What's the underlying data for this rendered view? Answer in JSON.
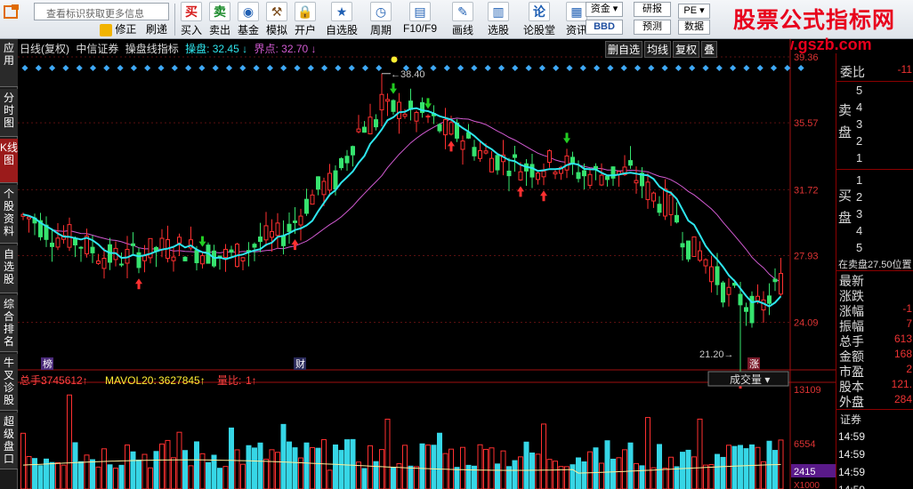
{
  "toolbar": {
    "search_placeholder": "查看标识获取更多信息",
    "sub_buttons": [
      "修正",
      "刷递"
    ],
    "buttons": [
      {
        "id": "buy",
        "label": "买入",
        "icon": "buy-icon",
        "glyph": "买",
        "color": "#d61b1b"
      },
      {
        "id": "sell",
        "label": "卖出",
        "icon": "sell-icon",
        "glyph": "卖",
        "color": "#1a8a2a"
      },
      {
        "id": "fund",
        "label": "基金",
        "icon": "fund-icon",
        "glyph": "◉",
        "color": "#1f5fb3"
      },
      {
        "id": "simulate",
        "label": "模拟",
        "icon": "hammer-icon",
        "glyph": "⚒",
        "color": "#7a4a1a"
      },
      {
        "id": "open",
        "label": "开户",
        "icon": "lock-icon",
        "glyph": "🔒",
        "color": "#555"
      },
      {
        "id": "watchlist",
        "label": "自选股",
        "icon": "star-icon",
        "glyph": "★",
        "color": "#1f5fb3"
      },
      {
        "id": "period",
        "label": "周期",
        "icon": "clock-icon",
        "glyph": "◷",
        "color": "#1f5fb3"
      },
      {
        "id": "f10",
        "label": "F10/F9",
        "icon": "document-icon",
        "glyph": "▤",
        "color": "#1f5fb3"
      },
      {
        "id": "draw",
        "label": "画线",
        "icon": "pencil-icon",
        "glyph": "✎",
        "color": "#1f5fb3"
      },
      {
        "id": "select",
        "label": "选股",
        "icon": "filter-icon",
        "glyph": "▥",
        "color": "#1f5fb3"
      },
      {
        "id": "forum",
        "label": "论股堂",
        "icon": "forum-icon",
        "glyph": "论",
        "color": "#1f5fb3"
      },
      {
        "id": "news",
        "label": "资讯",
        "icon": "news-icon",
        "glyph": "▦",
        "color": "#1f5fb3"
      }
    ],
    "mini_buttons": [
      "资金",
      "研报",
      "PE",
      "BBD",
      "预测",
      "数据"
    ]
  },
  "brand": {
    "title": "股票公式指标网",
    "url": "www.gszb.com"
  },
  "side_tabs": [
    {
      "label": "应用"
    },
    {
      "label": "分时图"
    },
    {
      "label": "K线图"
    },
    {
      "label": "个股资料"
    },
    {
      "label": "自选股"
    },
    {
      "label": "综合排名"
    },
    {
      "label": "牛叉诊股"
    },
    {
      "label": "超级盘口"
    }
  ],
  "chart_header": {
    "period": "日线(复权)",
    "stock": "中信证券",
    "indicator_name": "操盘线指标",
    "caopan_label": "操盘:",
    "caopan_value": "32.45",
    "jiedian_label": "界点:",
    "jiedian_value": "32.70"
  },
  "chart_tabs": [
    "删自选",
    "均线",
    "复权",
    "叠"
  ],
  "price_axis": [
    "39.36",
    "35.57",
    "31.72",
    "27.93",
    "24.09"
  ],
  "annotations": {
    "high": "38.40",
    "low": "21.20",
    "tag_bang": "榜",
    "tag_cai": "财",
    "tag_zhang": "涨"
  },
  "volume_header": {
    "total_label": "总手:",
    "total_value": "3745612",
    "mavol_label": "MAVOL20:",
    "mavol_value": "3627845",
    "ratio_label": "量比:",
    "ratio_value": "1",
    "dropdown": "成交量"
  },
  "volume_axis": [
    "13109",
    "6554",
    "2415",
    "X1000"
  ],
  "chart_data": {
    "type": "candlestick",
    "price_range": [
      21.2,
      39.36
    ],
    "volume_unit": "X1000",
    "volume_range": [
      0,
      13109
    ],
    "series": [
      {
        "name": "操盘",
        "color": "#2ee6ee"
      },
      {
        "name": "界点",
        "color": "#d05ad0"
      }
    ]
  },
  "quote": {
    "weibi_label": "委比",
    "weibi_value": "-11",
    "sell_label": "卖盘",
    "buy_label": "买盘",
    "levels": [
      "5",
      "4",
      "3",
      "2",
      "1"
    ],
    "sell_note": "在卖盘27.50位置",
    "stats": [
      {
        "label": "最新",
        "value": ""
      },
      {
        "label": "涨跌",
        "value": ""
      },
      {
        "label": "涨幅",
        "value": "-1"
      },
      {
        "label": "振幅",
        "value": "7"
      },
      {
        "label": "总手",
        "value": "613"
      },
      {
        "label": "金额",
        "value": "168"
      },
      {
        "label": "市盈",
        "value": "2"
      },
      {
        "label": "股本",
        "value": "121."
      },
      {
        "label": "外盘",
        "value": "284"
      }
    ],
    "trades_label": "证券",
    "trades": [
      "14:59",
      "14:59",
      "14:59",
      "14:59"
    ]
  }
}
